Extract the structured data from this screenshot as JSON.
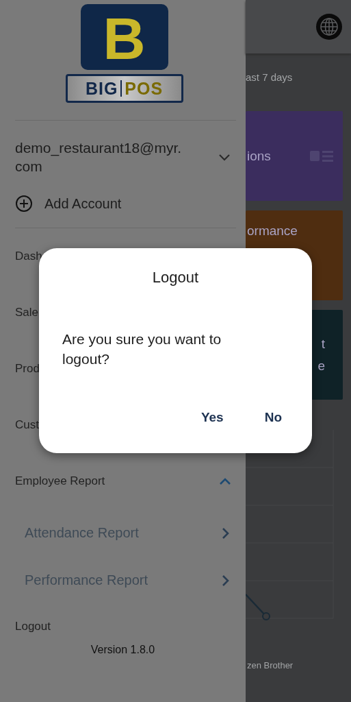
{
  "sidebar": {
    "logo": {
      "mark": "B",
      "left": "BIG",
      "right": "POS"
    },
    "account": {
      "email": "demo_restaurant18@myr.com",
      "expanded": false
    },
    "add_account": "Add Account",
    "items": [
      {
        "label": "Dash"
      },
      {
        "label": "Sale"
      },
      {
        "label": "Prod"
      },
      {
        "label": "Cust"
      },
      {
        "label": "Employee Report",
        "expanded": true,
        "children": [
          {
            "label": "Attendance Report"
          },
          {
            "label": "Performance Report"
          }
        ]
      },
      {
        "label": "Logout"
      }
    ],
    "version": "Version 1.8.0"
  },
  "main": {
    "period": "ast 7 days",
    "cards": [
      {
        "kind": "centered",
        "lines": [
          "ions"
        ],
        "color": "#3b2d5e",
        "icon": true
      },
      {
        "kind": "top",
        "lines": [
          "ormance"
        ],
        "color": "#4f2d10",
        "icon": false
      },
      {
        "kind": "trailing",
        "lines": [
          "t",
          "e"
        ],
        "color": "#0f2227",
        "icon": false
      }
    ],
    "chart_label": "zen Brother"
  },
  "dialog": {
    "title": "Logout",
    "message": "Are you sure you want to logout?",
    "buttons": [
      "Yes",
      "No"
    ]
  }
}
